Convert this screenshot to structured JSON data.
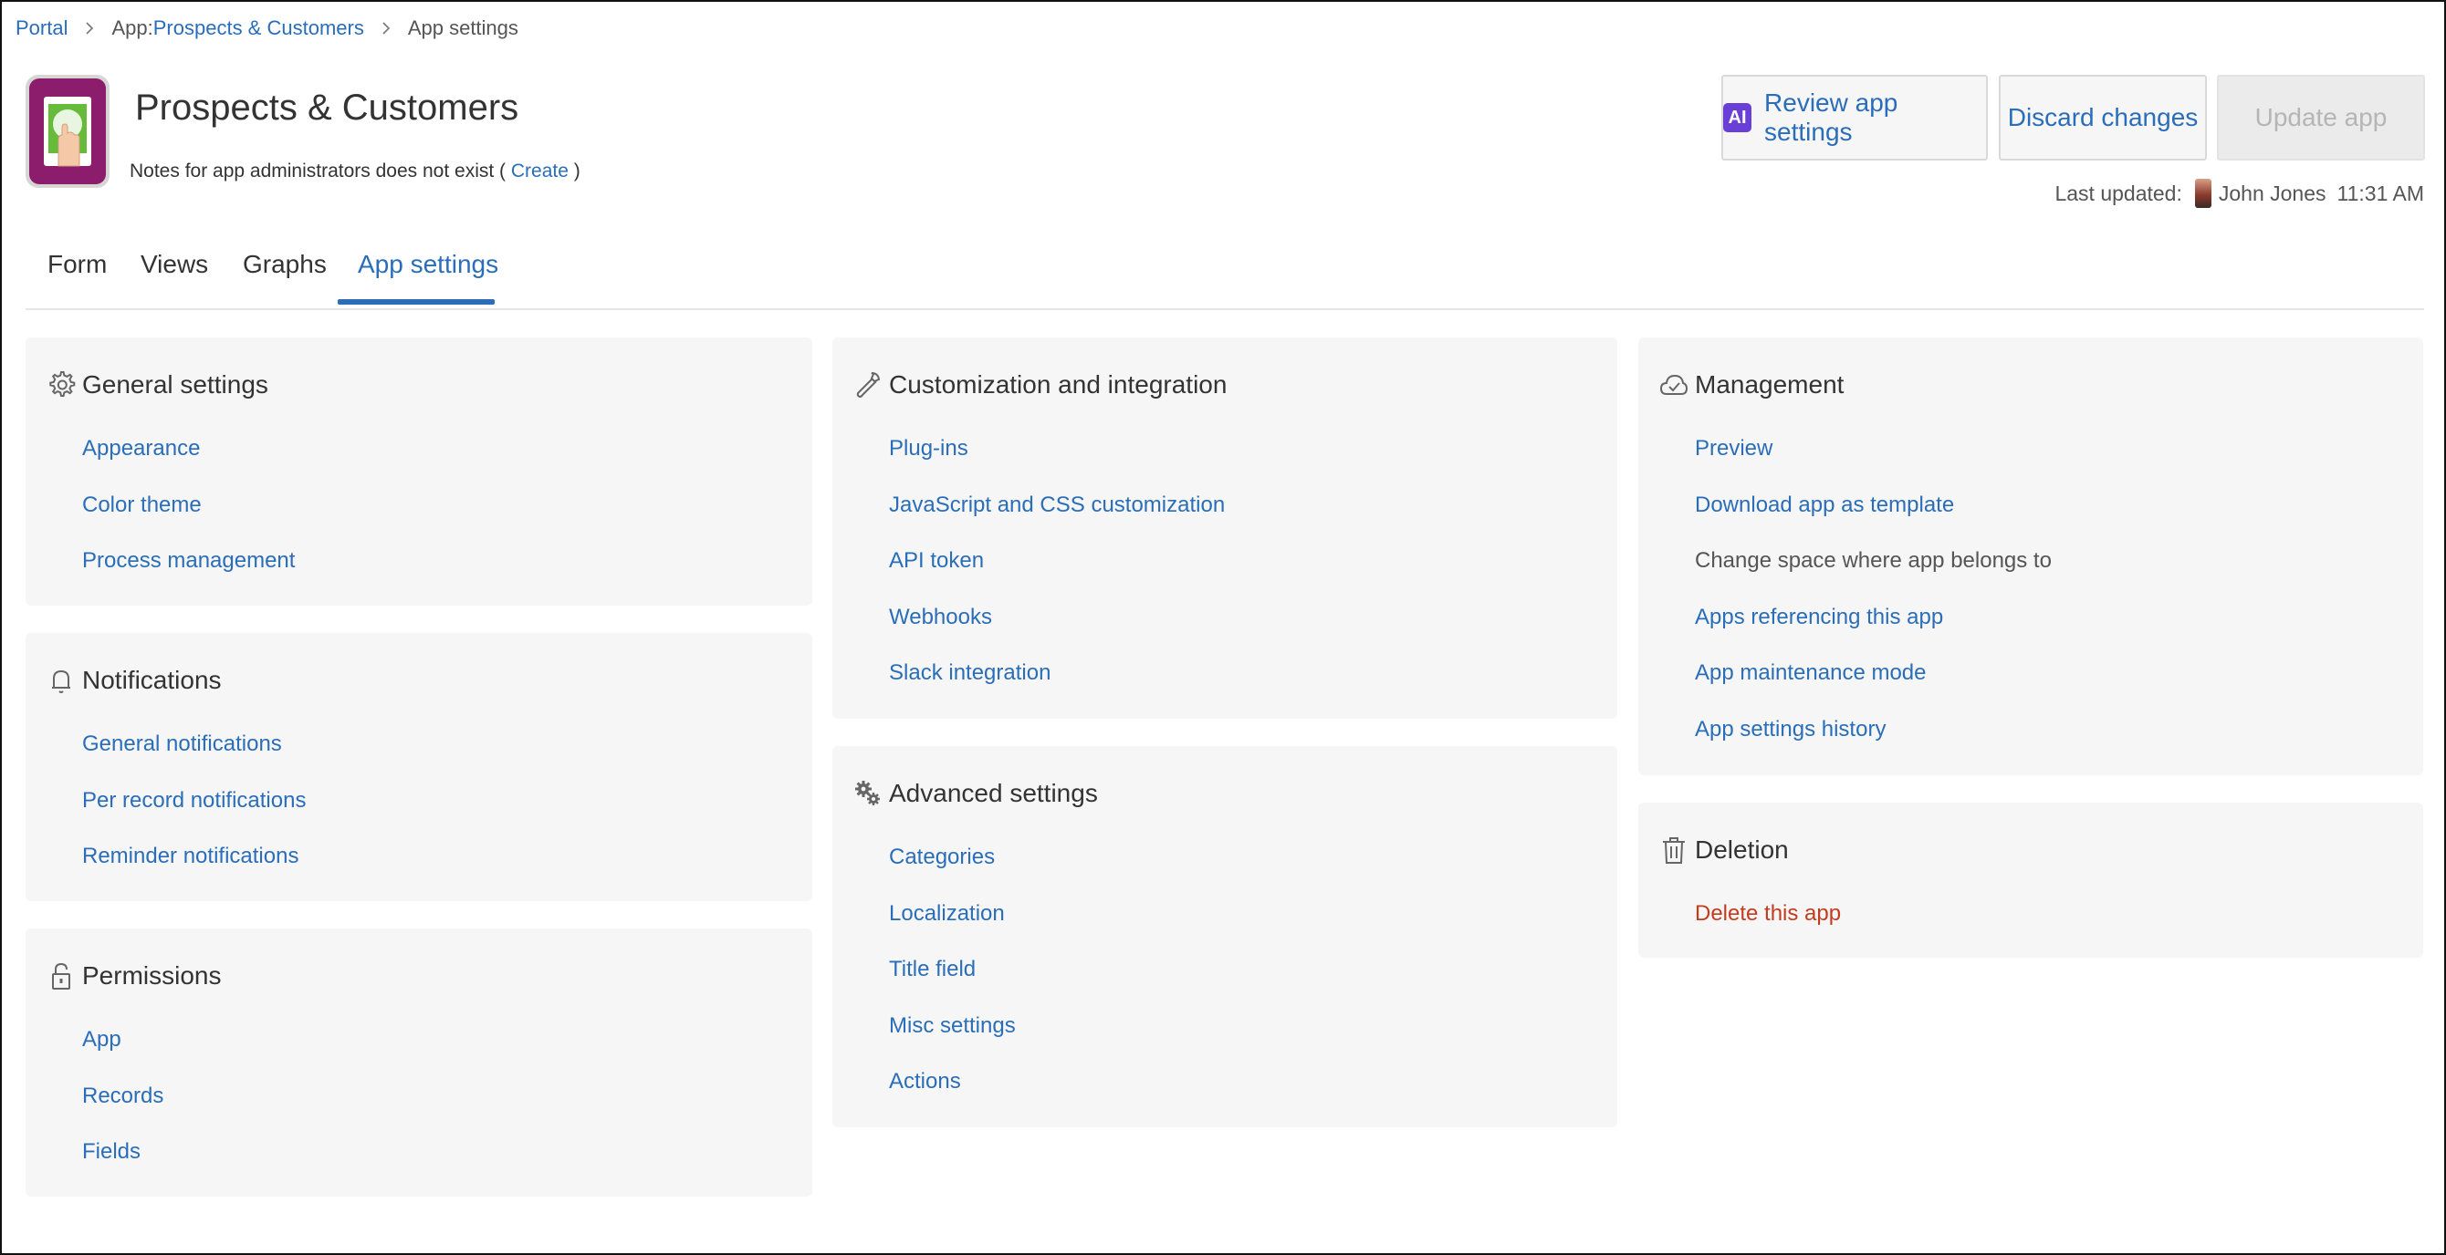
{
  "breadcrumb": {
    "portal": "Portal",
    "app_prefix": "App: ",
    "app_name": "Prospects & Customers",
    "current": "App settings"
  },
  "header": {
    "title": "Prospects & Customers",
    "notes_text": "Notes for app administrators does not exist (",
    "notes_create": "Create",
    "notes_close": ")",
    "last_updated_label": "Last updated:",
    "last_updated_user": "John Jones",
    "last_updated_time": "11:31 AM"
  },
  "buttons": {
    "ai_badge": "AI",
    "review": "Review app settings",
    "discard": "Discard changes",
    "update": "Update app"
  },
  "tabs": [
    {
      "label": "Form"
    },
    {
      "label": "Views"
    },
    {
      "label": "Graphs"
    },
    {
      "label": "App settings",
      "active": true
    }
  ],
  "sections": {
    "general": {
      "title": "General settings",
      "icon": "gear-icon",
      "items": [
        "Appearance",
        "Color theme",
        "Process management"
      ]
    },
    "notifications": {
      "title": "Notifications",
      "icon": "bell-icon",
      "items": [
        "General notifications",
        "Per record notifications",
        "Reminder notifications"
      ]
    },
    "permissions": {
      "title": "Permissions",
      "icon": "lock-icon",
      "items": [
        "App",
        "Records",
        "Fields"
      ]
    },
    "customization": {
      "title": "Customization and integration",
      "icon": "wrench-icon",
      "items": [
        "Plug-ins",
        "JavaScript and CSS customization",
        "API token",
        "Webhooks",
        "Slack integration"
      ]
    },
    "advanced": {
      "title": "Advanced settings",
      "icon": "gears-icon",
      "items": [
        "Categories",
        "Localization",
        "Title field",
        "Misc settings",
        "Actions"
      ]
    },
    "management": {
      "title": "Management",
      "icon": "cloud-check-icon",
      "items": [
        "Preview",
        "Download app as template",
        "Change space where app belongs to",
        "Apps referencing this app",
        "App maintenance mode",
        "App settings history"
      ]
    },
    "deletion": {
      "title": "Deletion",
      "icon": "trash-icon",
      "items": [
        "Delete this app"
      ]
    }
  },
  "colors": {
    "link": "#2a6db8",
    "danger": "#c43b1e",
    "app_icon_bg": "#8c1d6c",
    "ai_badge": "#6a3fd6",
    "card_bg": "#f6f6f6"
  }
}
